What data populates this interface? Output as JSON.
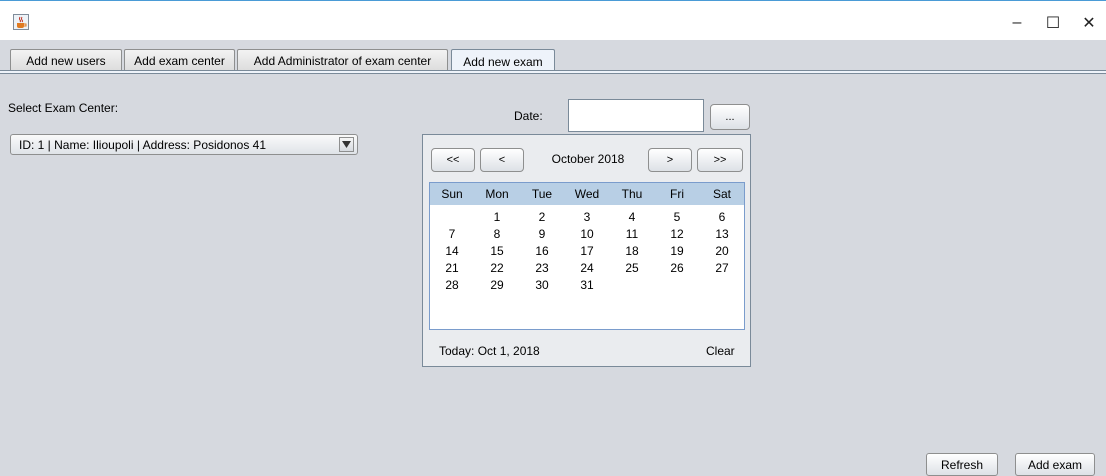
{
  "window": {
    "icon": "java-cup-icon",
    "minimize_glyph": "–",
    "maximize_glyph": "☐",
    "close_glyph": "✕"
  },
  "tabs": [
    {
      "label": "Add new users"
    },
    {
      "label": "Add exam center"
    },
    {
      "label": "Add Administrator of exam center"
    },
    {
      "label": "Add new exam"
    }
  ],
  "form": {
    "center_label": "Select Exam Center:",
    "center_selected": "ID: 1 | Name: Ilioupoli | Address: Posidonos 41",
    "date_label": "Date:",
    "date_value": "",
    "date_button_label": "..."
  },
  "calendar": {
    "prev_year": "<<",
    "prev_month": "<",
    "month_title": "October  2018",
    "next_month": ">",
    "next_year": ">>",
    "weekdays": [
      "Sun",
      "Mon",
      "Tue",
      "Wed",
      "Thu",
      "Fri",
      "Sat"
    ],
    "weeks": [
      [
        "",
        "1",
        "2",
        "3",
        "4",
        "5",
        "6"
      ],
      [
        "7",
        "8",
        "9",
        "10",
        "11",
        "12",
        "13"
      ],
      [
        "14",
        "15",
        "16",
        "17",
        "18",
        "19",
        "20"
      ],
      [
        "21",
        "22",
        "23",
        "24",
        "25",
        "26",
        "27"
      ],
      [
        "28",
        "29",
        "30",
        "31",
        "",
        "",
        ""
      ]
    ],
    "today_text": "Today: Oct 1, 2018",
    "clear_text": "Clear",
    "header_color": "#b8cfe5"
  },
  "actions": {
    "refresh_label": "Refresh",
    "add_exam_label": "Add exam"
  }
}
